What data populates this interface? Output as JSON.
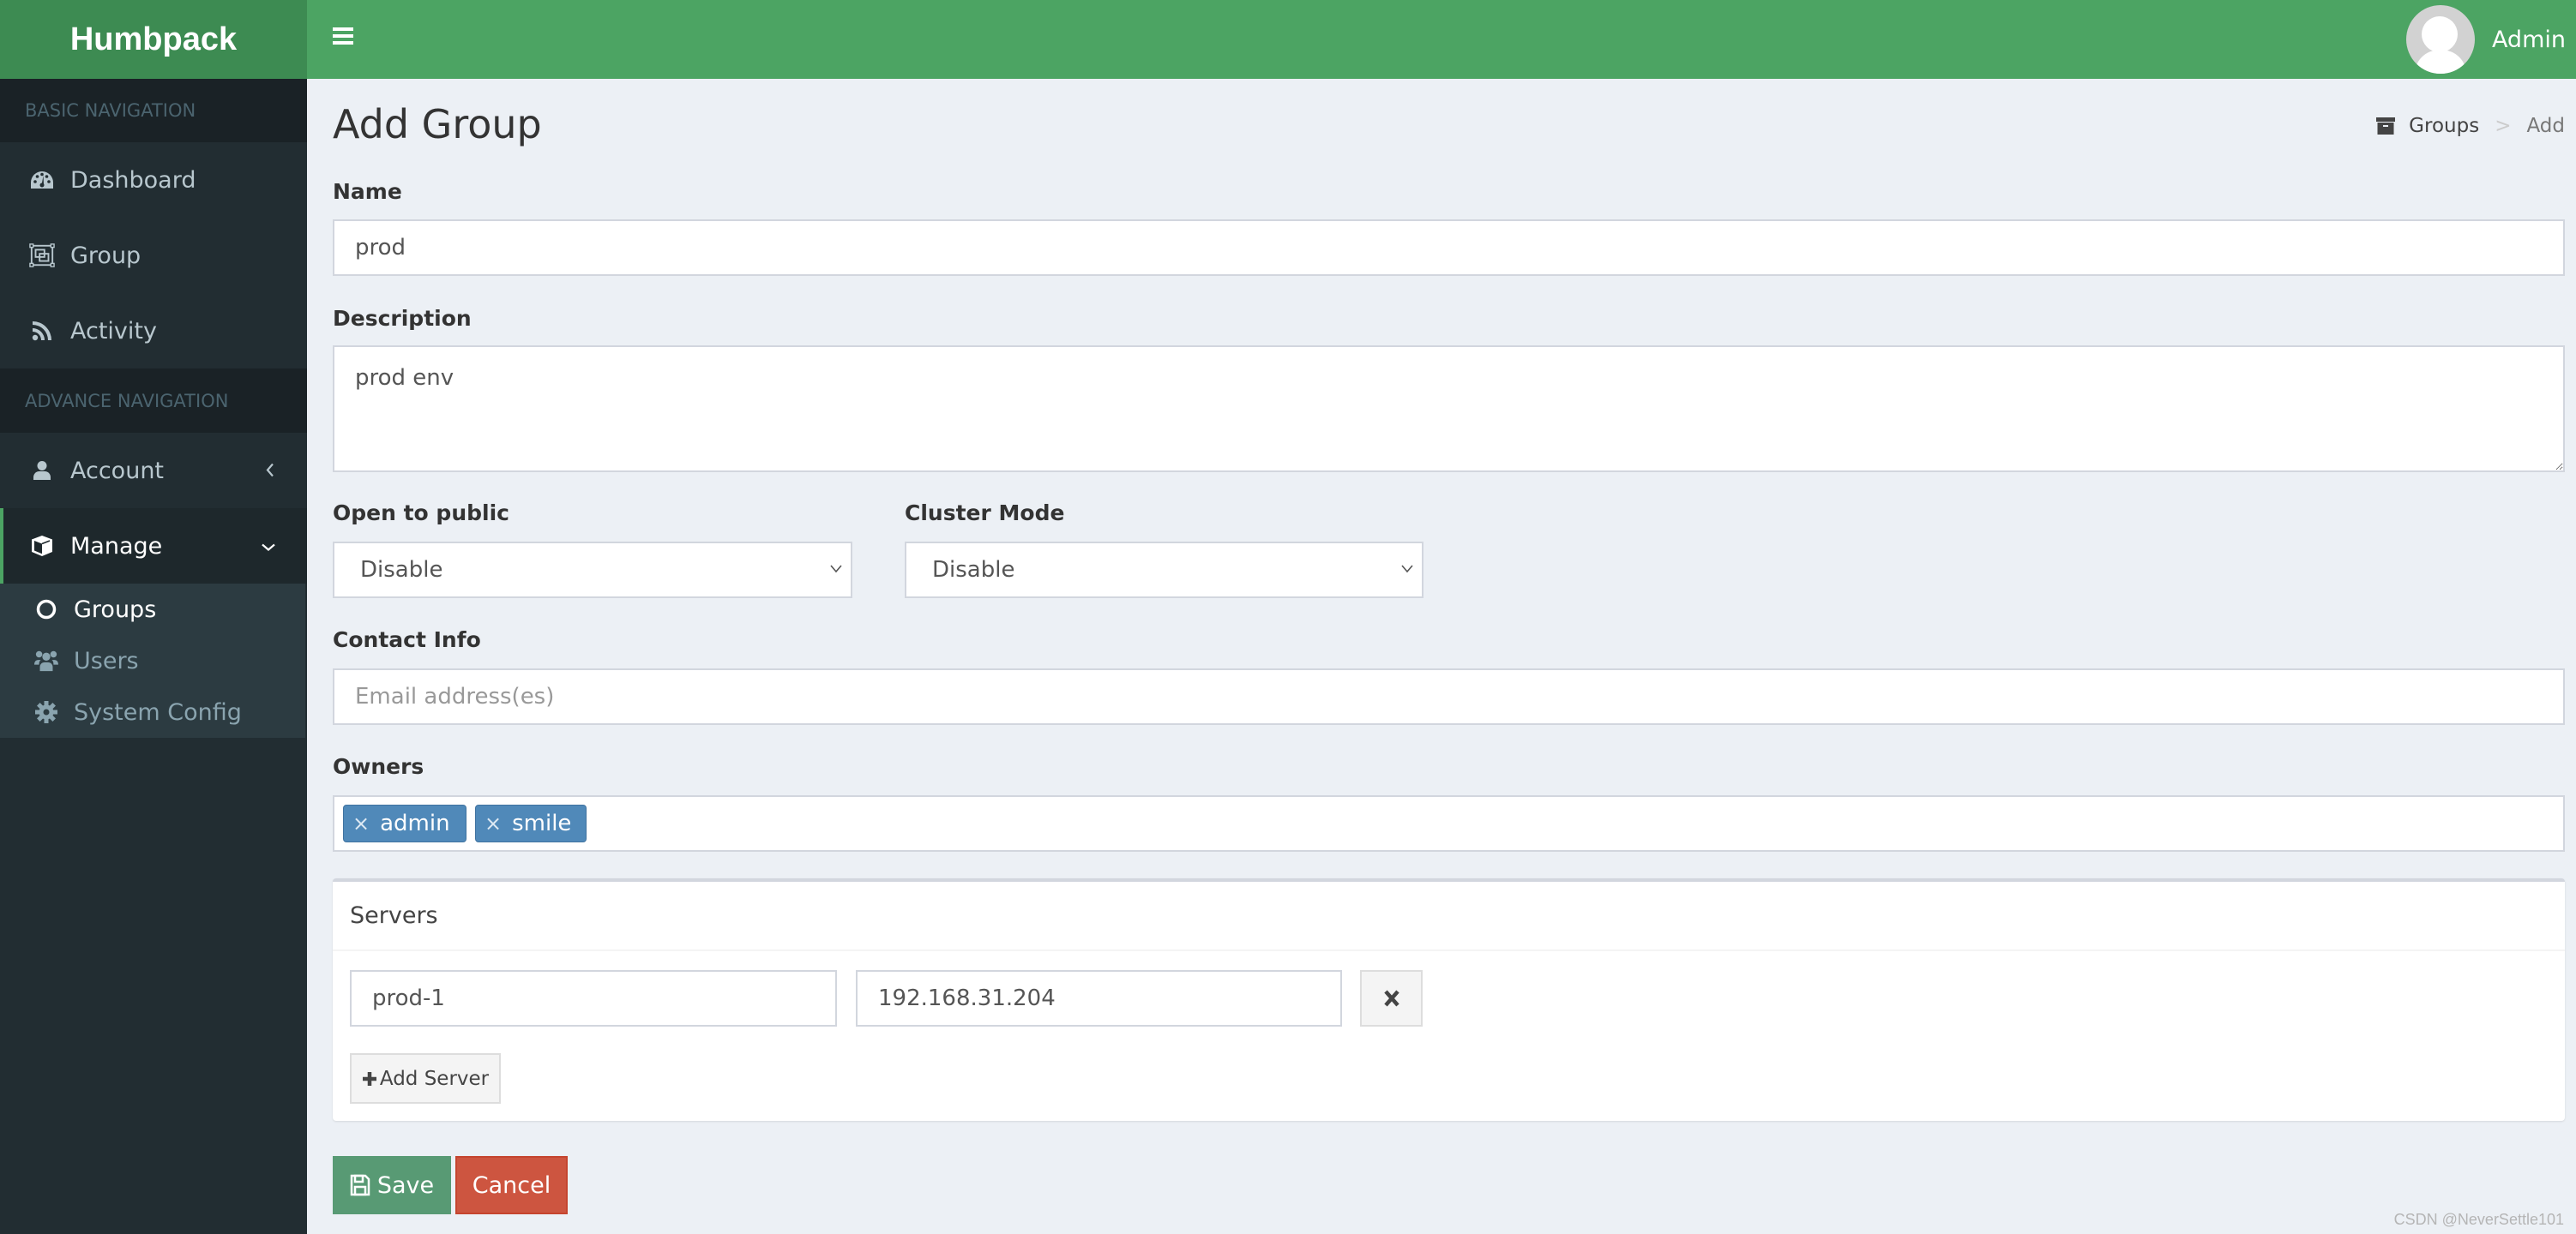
{
  "header": {
    "logo": "Humbpack",
    "user_name": "Admin"
  },
  "sidebar": {
    "sections": [
      {
        "title": "BASIC NAVIGATION",
        "items": [
          {
            "label": "Dashboard",
            "icon": "dashboard-icon"
          },
          {
            "label": "Group",
            "icon": "object-group-icon"
          },
          {
            "label": "Activity",
            "icon": "rss-icon"
          }
        ]
      },
      {
        "title": "ADVANCE NAVIGATION",
        "items": [
          {
            "label": "Account",
            "icon": "user-icon",
            "expanded": false
          },
          {
            "label": "Manage",
            "icon": "cube-icon",
            "expanded": true,
            "active": true,
            "children": [
              {
                "label": "Groups",
                "icon": "circle-icon",
                "active": true
              },
              {
                "label": "Users",
                "icon": "users-icon"
              },
              {
                "label": "System Config",
                "icon": "gear-icon"
              }
            ]
          }
        ]
      }
    ]
  },
  "page": {
    "title": "Add Group",
    "breadcrumb": {
      "parent": "Groups",
      "separator": ">",
      "current": "Add"
    }
  },
  "form": {
    "name": {
      "label": "Name",
      "value": "prod"
    },
    "description": {
      "label": "Description",
      "value": "prod env"
    },
    "open_to_public": {
      "label": "Open to public",
      "value": "Disable"
    },
    "cluster_mode": {
      "label": "Cluster Mode",
      "value": "Disable"
    },
    "contact_info": {
      "label": "Contact Info",
      "value": "",
      "placeholder": "Email address(es)"
    },
    "owners": {
      "label": "Owners",
      "tags": [
        "admin",
        "smile"
      ],
      "remove_glyph": "×"
    },
    "servers": {
      "title": "Servers",
      "rows": [
        {
          "name": "prod-1",
          "ip": "192.168.31.204"
        }
      ],
      "add_label": "Add Server"
    },
    "save_label": "Save",
    "cancel_label": "Cancel"
  },
  "colors": {
    "brand_green": "#4ca463",
    "logo_green": "#3d8b52",
    "sidebar_bg": "#222d32",
    "save": "#589a74",
    "cancel": "#cd5540",
    "tag": "#5089b9"
  },
  "watermark": "CSDN @NeverSettle101"
}
